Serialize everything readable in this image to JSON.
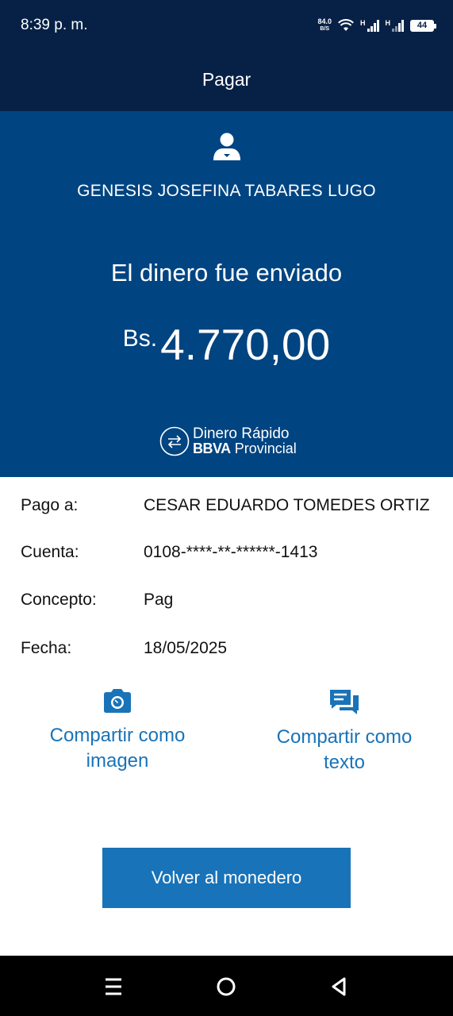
{
  "status_bar": {
    "time": "8:39 p. m.",
    "net_speed": "84.0",
    "net_speed_unit": "B/S",
    "signal_label_1": "H",
    "signal_label_2": "H",
    "battery": "44"
  },
  "header": {
    "title": "Pagar"
  },
  "hero": {
    "recipient_name": "GENESIS JOSEFINA TABARES LUGO",
    "message": "El dinero fue enviado",
    "currency": "Bs.",
    "amount": "4.770,00",
    "brand_line1": "Dinero Rápido",
    "brand_bold": "BBVA",
    "brand_rest": "Provincial"
  },
  "details": {
    "rows": [
      {
        "label": "Pago a:",
        "value": "CESAR EDUARDO TOMEDES ORTIZ"
      },
      {
        "label": "Cuenta:",
        "value": "0108-****-**-******-1413"
      },
      {
        "label": "Concepto:",
        "value": "Pag"
      },
      {
        "label": "Fecha:",
        "value": "18/05/2025"
      }
    ]
  },
  "actions": {
    "share_image_line1": "Compartir como",
    "share_image_line2": "imagen",
    "share_text_line1": "Compartir como",
    "share_text_line2": "texto",
    "back_button": "Volver al monedero"
  },
  "colors": {
    "header_bg": "#072146",
    "hero_bg": "#004481",
    "accent": "#1973b8"
  },
  "icons": [
    "wifi-icon",
    "signal-icon",
    "battery-icon",
    "user-icon",
    "transfer-icon",
    "camera-icon",
    "chat-icon",
    "menu-icon",
    "home-icon",
    "back-icon"
  ]
}
